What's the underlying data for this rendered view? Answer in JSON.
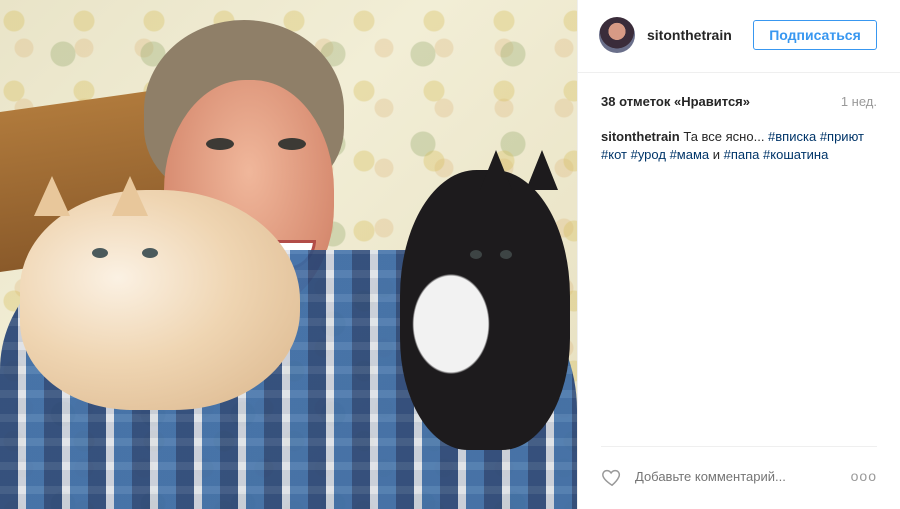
{
  "post": {
    "username": "sitonthetrain",
    "follow_label": "Подписаться",
    "likes": "38 отметок «Нравится»",
    "time_ago": "1 нед.",
    "caption_user": "sitonthetrain",
    "caption_text": " Та все ясно... ",
    "tags": [
      "#вписка",
      "#приют",
      "#кот",
      "#урод",
      "#мама"
    ],
    "and_word": " и ",
    "tag_papa": "#папа",
    "tag_last": "#кошатина",
    "comment_placeholder": "Добавьте комментарий...",
    "more_label": "ooo"
  },
  "icons": {
    "like": "heart-icon",
    "more": "more-options-icon"
  },
  "colors": {
    "accent": "#3897f0",
    "hashtag": "#003569",
    "muted": "#999999"
  }
}
